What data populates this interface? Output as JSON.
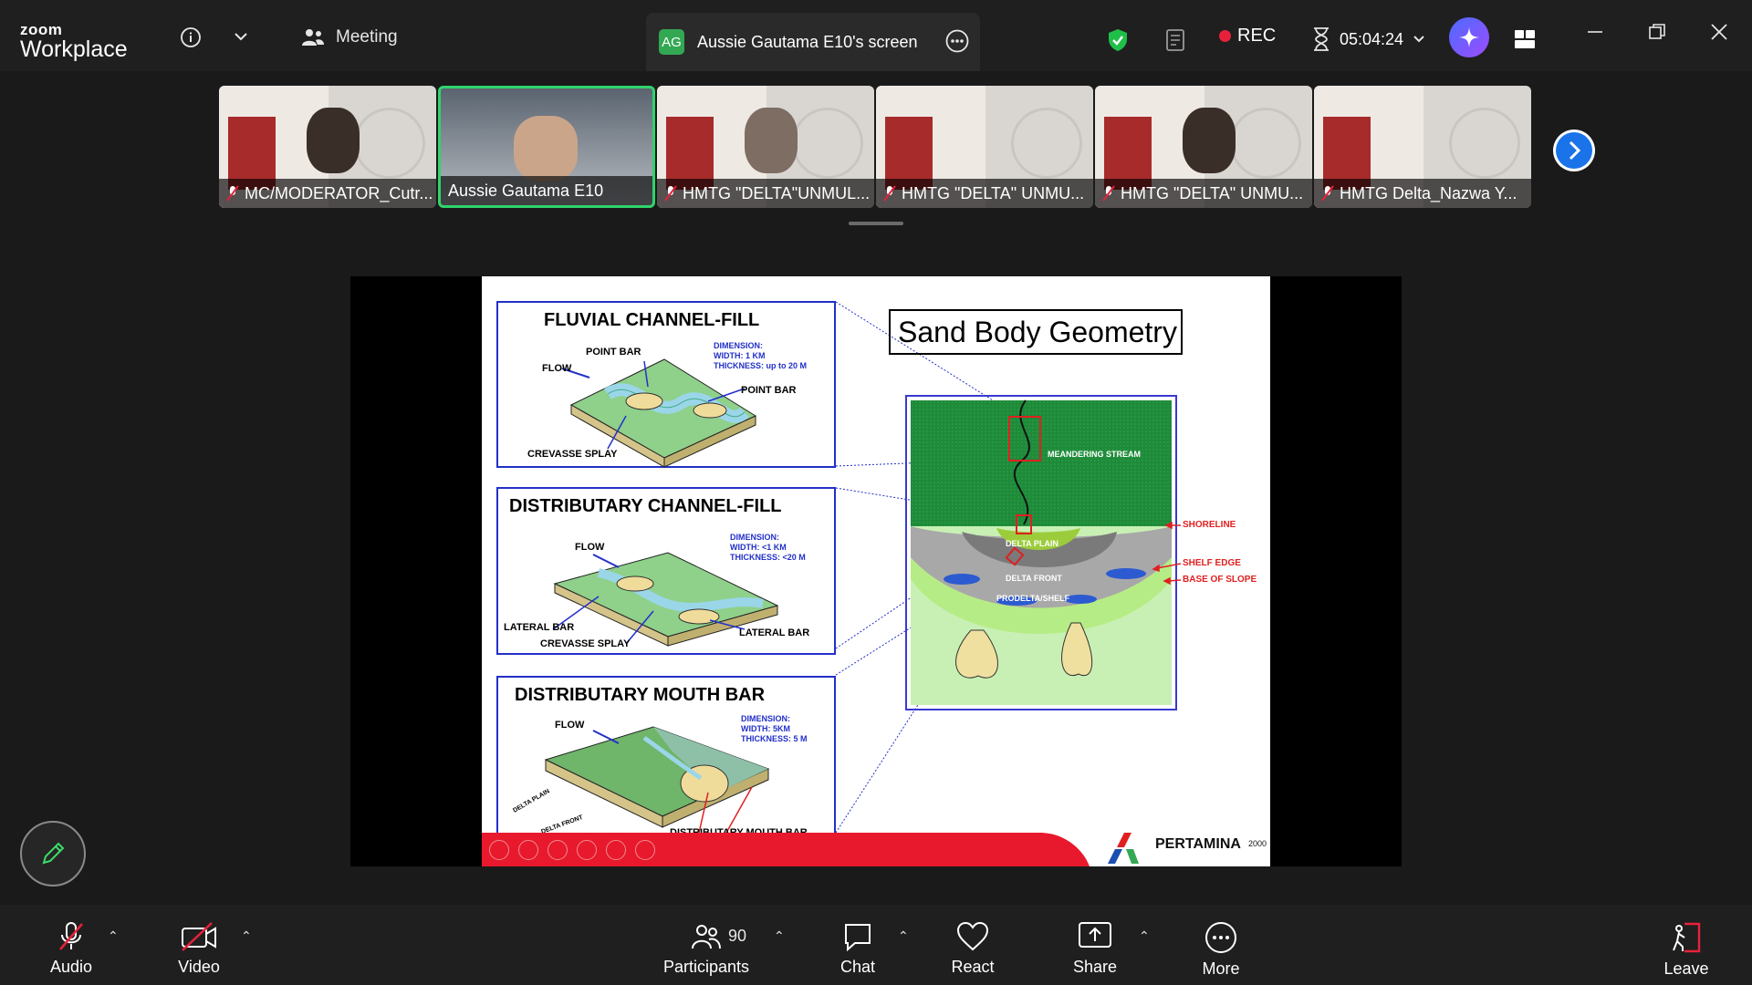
{
  "app": {
    "brand_top": "zoom",
    "brand_bottom": "Workplace"
  },
  "topbar": {
    "meeting_label": "Meeting",
    "screen_initials": "AG",
    "screen_label": "Aussie Gautama E10's screen",
    "rec_label": "REC",
    "timer": "05:04:24"
  },
  "participants_strip": [
    {
      "name": "MC/MODERATOR_Cutr...",
      "muted": true
    },
    {
      "name": "Aussie Gautama E10",
      "muted": false
    },
    {
      "name": "HMTG \"DELTA\"UNMUL...",
      "muted": true
    },
    {
      "name": "HMTG \"DELTA\" UNMU...",
      "muted": true
    },
    {
      "name": "HMTG \"DELTA\" UNMU...",
      "muted": true
    },
    {
      "name": "HMTG Delta_Nazwa Y...",
      "muted": true
    }
  ],
  "slide": {
    "title": "Sand Body Geometry",
    "panels": [
      {
        "heading": "FLUVIAL CHANNEL-FILL",
        "dimension": [
          "DIMENSION:",
          "WIDTH: 1 KM",
          "THICKNESS: up to 20 M"
        ],
        "labels": [
          "FLOW",
          "POINT BAR",
          "POINT BAR",
          "CREVASSE SPLAY"
        ]
      },
      {
        "heading": "DISTRIBUTARY CHANNEL-FILL",
        "dimension": [
          "DIMENSION:",
          "WIDTH: <1 KM",
          "THICKNESS: <20 M"
        ],
        "labels": [
          "FLOW",
          "LATERAL BAR",
          "CREVASSE SPLAY",
          "LATERAL BAR"
        ]
      },
      {
        "heading": "DISTRIBUTARY MOUTH BAR",
        "dimension": [
          "DIMENSION:",
          "WIDTH: 5KM",
          "THICKNESS: 5 M"
        ],
        "labels": [
          "FLOW",
          "DELTA PLAIN",
          "DELTA FRONT",
          "DISTRIBUTARY MOUTH BAR"
        ]
      }
    ],
    "delta_labels": {
      "stream": "MEANDERING STREAM",
      "plain": "DELTA PLAIN",
      "front": "DELTA FRONT",
      "prodelta": "PRODELTA/SHELF",
      "shoreline": "SHORELINE",
      "shelf_edge": "SHELF EDGE",
      "base_slope": "BASE OF SLOPE"
    },
    "logo_text": "PERTAMINA",
    "year": "2000"
  },
  "bottombar": {
    "audio": "Audio",
    "video": "Video",
    "participants": "Participants",
    "participant_count": "90",
    "chat": "Chat",
    "react": "React",
    "share": "Share",
    "more": "More",
    "leave": "Leave"
  },
  "colors": {
    "accent_green": "#2fd46b",
    "rec_red": "#e8213b",
    "diagram_blue": "#2230c8",
    "band_red": "#e8192c"
  }
}
